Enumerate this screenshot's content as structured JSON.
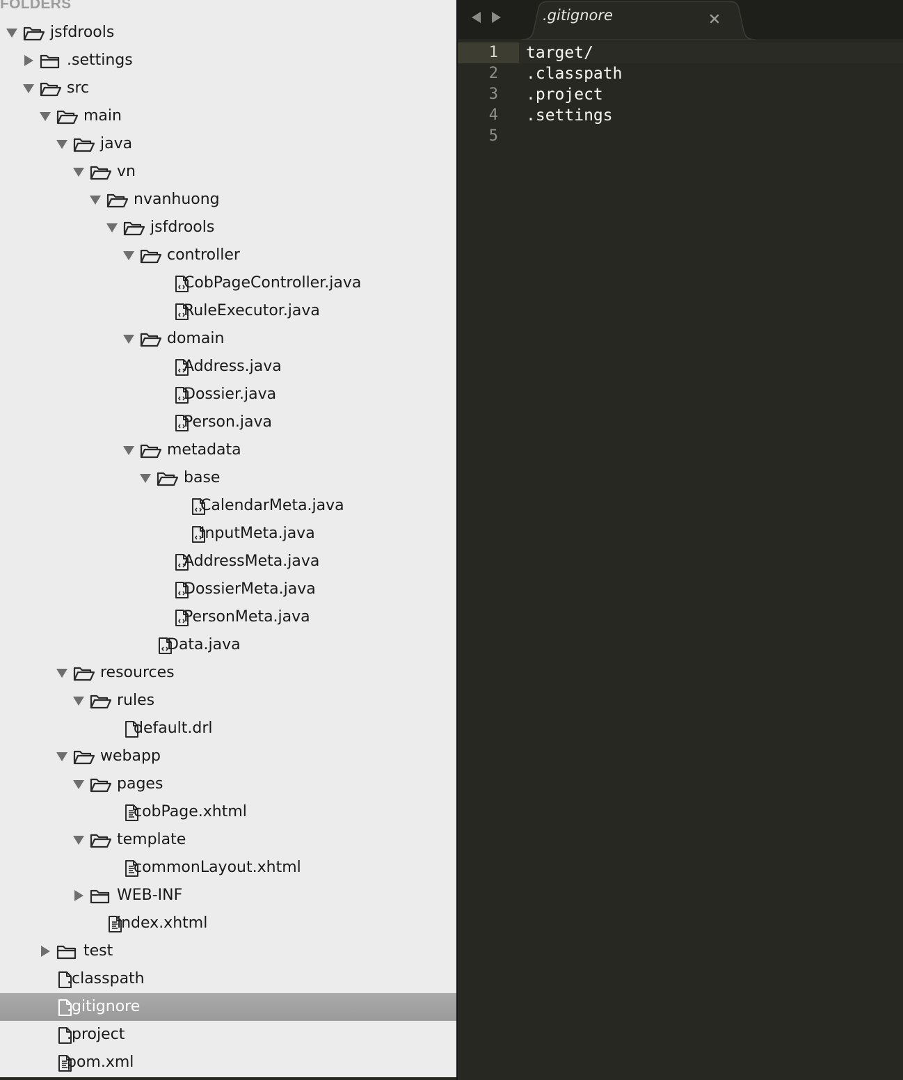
{
  "sidebar": {
    "heading": "FOLDERS",
    "rows": [
      {
        "label": "jsfdrools",
        "type": "folder",
        "depth": 0,
        "expanded": true
      },
      {
        "label": ".settings",
        "type": "folder",
        "depth": 1,
        "expanded": false
      },
      {
        "label": "src",
        "type": "folder",
        "depth": 1,
        "expanded": true
      },
      {
        "label": "main",
        "type": "folder",
        "depth": 2,
        "expanded": true
      },
      {
        "label": "java",
        "type": "folder",
        "depth": 3,
        "expanded": true
      },
      {
        "label": "vn",
        "type": "folder",
        "depth": 4,
        "expanded": true
      },
      {
        "label": "nvanhuong",
        "type": "folder",
        "depth": 5,
        "expanded": true
      },
      {
        "label": "jsfdrools",
        "type": "folder",
        "depth": 6,
        "expanded": true
      },
      {
        "label": "controller",
        "type": "folder",
        "depth": 7,
        "expanded": true
      },
      {
        "label": "CobPageController.java",
        "type": "code-file",
        "depth": 8
      },
      {
        "label": "RuleExecutor.java",
        "type": "code-file",
        "depth": 8
      },
      {
        "label": "domain",
        "type": "folder",
        "depth": 7,
        "expanded": true
      },
      {
        "label": "Address.java",
        "type": "code-file",
        "depth": 8
      },
      {
        "label": "Dossier.java",
        "type": "code-file",
        "depth": 8
      },
      {
        "label": "Person.java",
        "type": "code-file",
        "depth": 8
      },
      {
        "label": "metadata",
        "type": "folder",
        "depth": 7,
        "expanded": true
      },
      {
        "label": "base",
        "type": "folder",
        "depth": 8,
        "expanded": true
      },
      {
        "label": "CalendarMeta.java",
        "type": "code-file",
        "depth": 9
      },
      {
        "label": "InputMeta.java",
        "type": "code-file",
        "depth": 9
      },
      {
        "label": "AddressMeta.java",
        "type": "code-file",
        "depth": 8
      },
      {
        "label": "DossierMeta.java",
        "type": "code-file",
        "depth": 8
      },
      {
        "label": "PersonMeta.java",
        "type": "code-file",
        "depth": 8
      },
      {
        "label": "Data.java",
        "type": "code-file",
        "depth": 7
      },
      {
        "label": "resources",
        "type": "folder",
        "depth": 3,
        "expanded": true
      },
      {
        "label": "rules",
        "type": "folder",
        "depth": 4,
        "expanded": true
      },
      {
        "label": "default.drl",
        "type": "plain-file",
        "depth": 5
      },
      {
        "label": "webapp",
        "type": "folder",
        "depth": 3,
        "expanded": true
      },
      {
        "label": "pages",
        "type": "folder",
        "depth": 4,
        "expanded": true
      },
      {
        "label": "cobPage.xhtml",
        "type": "markup-file",
        "depth": 5
      },
      {
        "label": "template",
        "type": "folder",
        "depth": 4,
        "expanded": true
      },
      {
        "label": "commonLayout.xhtml",
        "type": "markup-file",
        "depth": 5
      },
      {
        "label": "WEB-INF",
        "type": "folder",
        "depth": 4,
        "expanded": false
      },
      {
        "label": "index.xhtml",
        "type": "markup-file",
        "depth": 4
      },
      {
        "label": "test",
        "type": "folder",
        "depth": 2,
        "expanded": false
      },
      {
        "label": ".classpath",
        "type": "plain-file",
        "depth": 1
      },
      {
        "label": ".gitignore",
        "type": "plain-file",
        "depth": 1,
        "selected": true
      },
      {
        "label": ".project",
        "type": "plain-file",
        "depth": 1
      },
      {
        "label": "pom.xml",
        "type": "markup-file",
        "depth": 1
      }
    ]
  },
  "editor": {
    "nav_back_icon": "triangle-left-icon",
    "nav_forward_icon": "triangle-right-icon",
    "tab": {
      "title": ".gitignore",
      "close_icon": "close-icon"
    },
    "active_line": 1,
    "lines": [
      "target/",
      ".classpath",
      ".project",
      ".settings",
      ""
    ]
  },
  "colors": {
    "sidebar_bg": "#ececec",
    "selected_row": "#a3a3a3",
    "editor_bg": "#272822",
    "editor_text": "#f8f8f2",
    "gutter_text": "#8f908a"
  }
}
